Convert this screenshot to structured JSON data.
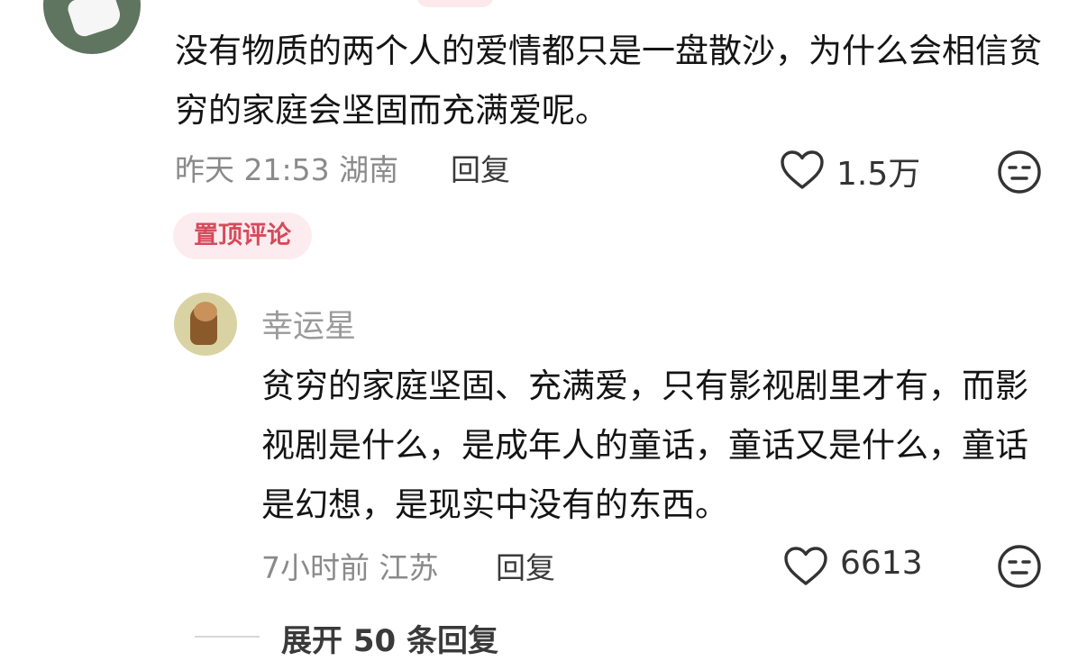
{
  "comment": {
    "text": "没有物质的两个人的爱情都只是一盘散沙，为什么会相信贫穷的家庭会坚固而充满爱呢。",
    "meta": "昨天 21:53 湖南",
    "reply_label": "回复",
    "like_icon": "heart-outline-icon",
    "likes": "1.5万",
    "dislike_icon": "neutral-face-icon",
    "pinned_label": "置顶评论"
  },
  "reply": {
    "author": "幸运星",
    "text": "贫穷的家庭坚固、充满爱，只有影视剧里才有，而影视剧是什么，是成年人的童话，童话又是什么，童话是幻想，是现实中没有的东西。",
    "meta": "7小时前 江苏",
    "reply_label": "回复",
    "like_icon": "heart-outline-icon",
    "likes": "6613",
    "dislike_icon": "neutral-face-icon"
  },
  "expand": {
    "label": "展开 50 条回复"
  },
  "colors": {
    "pinned_bg": "#fdecef",
    "pinned_text": "#d44b5b",
    "meta_gray": "#8a8a8a"
  }
}
